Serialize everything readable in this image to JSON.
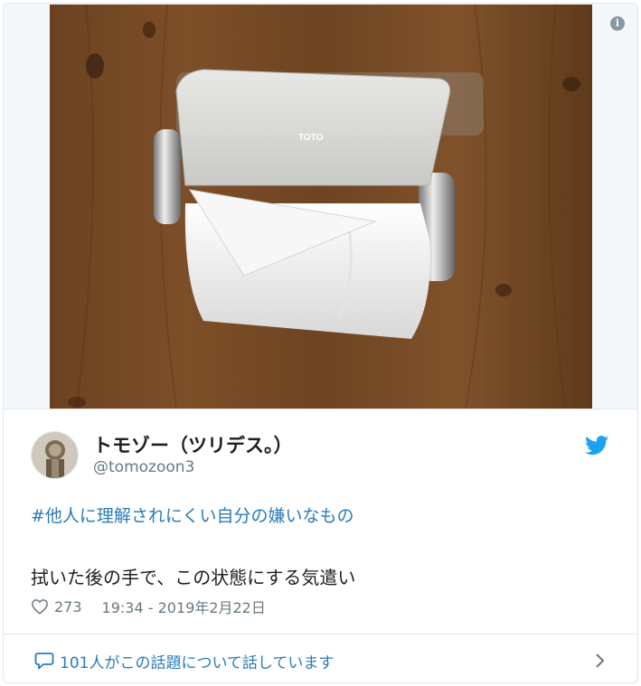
{
  "tweet": {
    "image_alt": "toilet paper roll in holder with folded triangle tip",
    "holder_brand": "TOTO",
    "author": {
      "name": "トモゾー（ツリデス。）",
      "handle": "@tomozoon3"
    },
    "hashtag": "#他人に理解されにくい自分の嫌いなもの",
    "text": "拭いた後の手で、この状態にする気遣い",
    "likes": "273",
    "timestamp": "19:34 - 2019年2月22日",
    "footer_text": "101人がこの話題について話しています"
  },
  "icons": {
    "info": "info-icon",
    "twitter": "twitter-bird-icon",
    "heart": "heart-icon",
    "reply": "speech-bubble-icon",
    "chevron": "chevron-right-icon"
  },
  "colors": {
    "link": "#2b7bb9",
    "twitter_blue": "#1da1f2",
    "muted": "#697882",
    "border": "#e1e8ed"
  }
}
